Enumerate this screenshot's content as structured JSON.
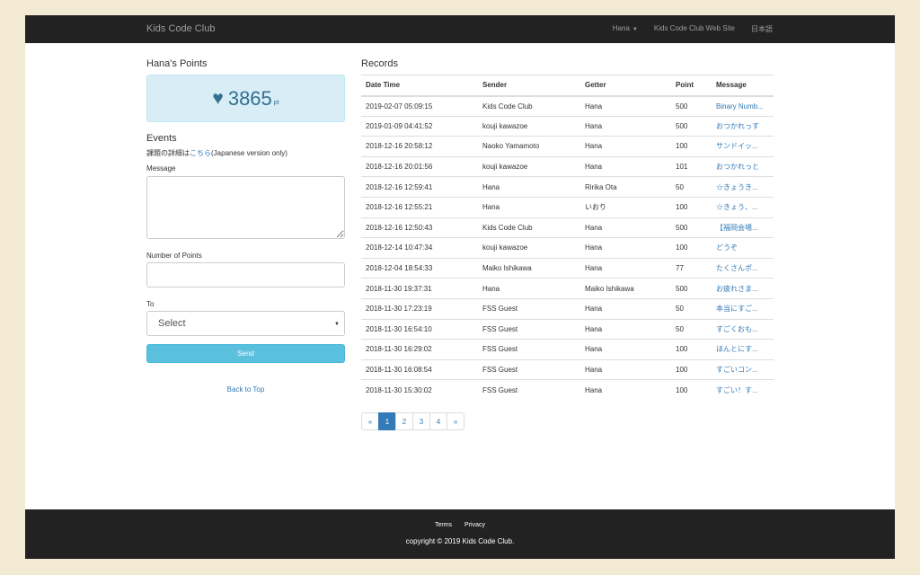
{
  "navbar": {
    "brand": "Kids Code Club",
    "user_menu": "Hana",
    "web_site": "Kids Code Club Web Site",
    "language": "日本語"
  },
  "points": {
    "title": "Hana's Points",
    "value": "3865",
    "unit": "pt",
    "icon": "heart-icon",
    "box_bg": "#d9edf7",
    "text_color": "#31708f"
  },
  "events": {
    "title": "Events",
    "note_prefix": "課題の詳細は",
    "note_link": "こちら",
    "note_suffix": "(Japanese version only)"
  },
  "form": {
    "message_label": "Message",
    "message_value": "",
    "points_label": "Number of Points",
    "points_value": "",
    "to_label": "To",
    "to_selected": "Select",
    "send_label": "Send",
    "back_label": "Back to Top",
    "send_color": "#5bc0de"
  },
  "records": {
    "title": "Records",
    "columns": [
      "Date Time",
      "Sender",
      "Getter",
      "Point",
      "Message"
    ],
    "rows": [
      [
        "2019-02-07 05:09:15",
        "Kids Code Club",
        "Hana",
        "500",
        "Binary Numb..."
      ],
      [
        "2019-01-09 04:41:52",
        "kouji kawazoe",
        "Hana",
        "500",
        "おつかれっす"
      ],
      [
        "2018-12-16 20:58:12",
        "Naoko Yamamoto",
        "Hana",
        "100",
        "サンドイッ..."
      ],
      [
        "2018-12-16 20:01:56",
        "kouji kawazoe",
        "Hana",
        "101",
        "おつかれっと"
      ],
      [
        "2018-12-16 12:59:41",
        "Hana",
        "Ririka Ota",
        "50",
        "☆きょうき..."
      ],
      [
        "2018-12-16 12:55:21",
        "Hana",
        "いおり",
        "100",
        "☆きょう、..."
      ],
      [
        "2018-12-16 12:50:43",
        "Kids Code Club",
        "Hana",
        "500",
        "【福岡会場..."
      ],
      [
        "2018-12-14 10:47:34",
        "kouji kawazoe",
        "Hana",
        "100",
        "どうぞ"
      ],
      [
        "2018-12-04 18:54:33",
        "Maiko Ishikawa",
        "Hana",
        "77",
        "たくさんポ..."
      ],
      [
        "2018-11-30 19:37:31",
        "Hana",
        "Maiko Ishikawa",
        "500",
        "お疲れさま..."
      ],
      [
        "2018-11-30 17:23:19",
        "FSS Guest",
        "Hana",
        "50",
        "本当にすご..."
      ],
      [
        "2018-11-30 16:54:10",
        "FSS Guest",
        "Hana",
        "50",
        "すごくおも..."
      ],
      [
        "2018-11-30 16:29:02",
        "FSS Guest",
        "Hana",
        "100",
        "ほんとにす..."
      ],
      [
        "2018-11-30 16:08:54",
        "FSS Guest",
        "Hana",
        "100",
        "すごいコン..."
      ],
      [
        "2018-11-30 15:30:02",
        "FSS Guest",
        "Hana",
        "100",
        "すごい！す..."
      ]
    ]
  },
  "pagination": {
    "prev": "«",
    "pages": [
      "1",
      "2",
      "3",
      "4"
    ],
    "next": "»",
    "active": "1"
  },
  "footer": {
    "terms": "Terms",
    "privacy": "Privacy",
    "copyright": "copyright © 2019 Kids Code Club."
  }
}
